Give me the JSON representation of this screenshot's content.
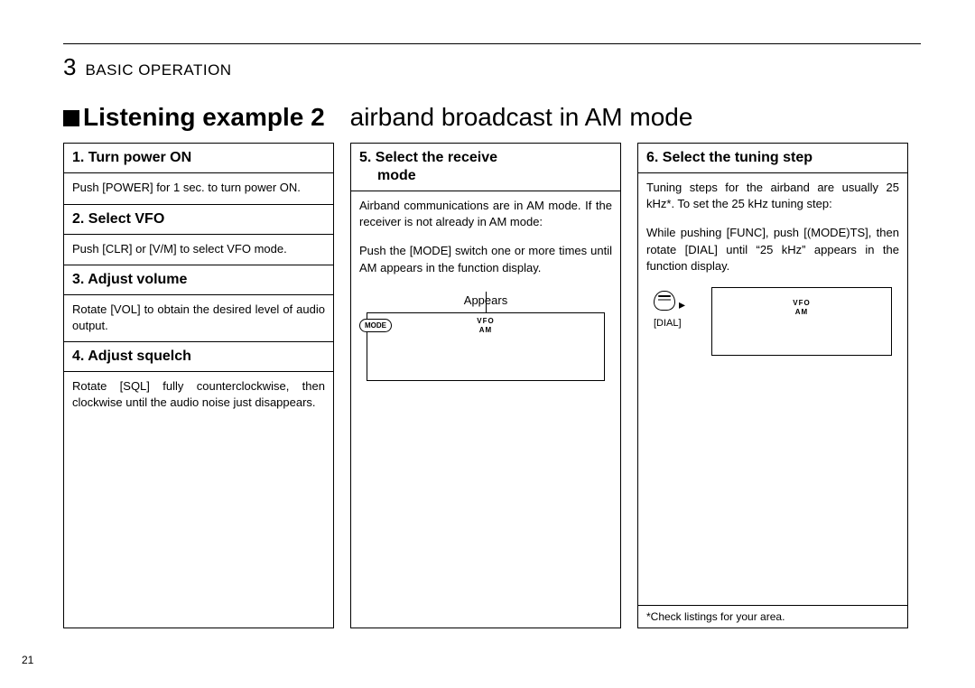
{
  "page": {
    "chapter_num": "3",
    "chapter_title": "BASIC OPERATION",
    "page_number": "21",
    "title_bold": "Listening example 2",
    "title_light": "airband broadcast in AM mode"
  },
  "col1": {
    "h1": "1. Turn power ON",
    "p1": "Push [POWER] for 1 sec. to turn power ON.",
    "h2": "2. Select VFO",
    "p2": "Push [CLR] or [V/M] to select VFO mode.",
    "h3": "3. Adjust volume",
    "p3": "Rotate [VOL] to obtain the desired level of audio output.",
    "h4": "4. Adjust squelch",
    "p4": "Rotate [SQL] fully counterclockwise, then clockwise until the audio noise just disappears."
  },
  "col2": {
    "h1_line1": "5. Select the receive",
    "h1_line2": "mode",
    "p1": "Airband communications are in AM mode. If the receiver is not already in AM mode:",
    "p2": "Push the [MODE] switch one or more times until AM appears in the function display.",
    "appears": "Appears",
    "mode_btn": "MODE",
    "lcd_line1": "VFO",
    "lcd_line2": "AM"
  },
  "col3": {
    "h1": "6. Select the tuning step",
    "p1": "Tuning steps for the airband are usually 25 kHz*. To set the 25 kHz tuning step:",
    "p2": "While pushing [FUNC], push [(MODE)TS], then rotate [DIAL] until “25 kHz” appears in the function display.",
    "dial_label": "[DIAL]",
    "lcd_line1": "VFO",
    "lcd_line2": "AM",
    "footnote": "*Check listings for your area."
  }
}
